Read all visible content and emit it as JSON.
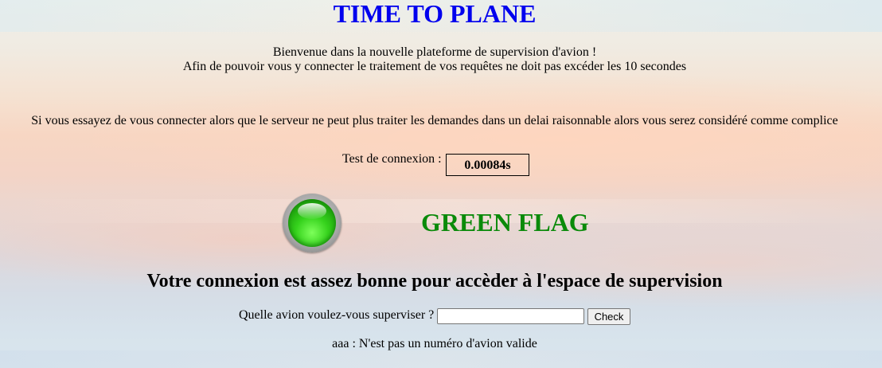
{
  "page": {
    "title": "TIME TO PLANE",
    "intro_line1": "Bienvenue dans la nouvelle plateforme de supervision d'avion !",
    "intro_line2": "Afin de pouvoir vous y connecter le traitement de vos requêtes ne doit pas excéder les 10 secondes",
    "warning": "Si vous essayez de vous connecter alors que le serveur ne peut plus traiter les demandes dans un delai raisonnable alors vous serez considéré comme complice"
  },
  "connection_test": {
    "label": "Test de connexion :",
    "value": "0.00084s"
  },
  "status": {
    "flag_text": "GREEN FLAG",
    "flag_color": "#0a8a0a",
    "light_icon": "green-light-icon",
    "message": "Votre connexion est assez bonne pour accèder à l'espace de supervision"
  },
  "plane_form": {
    "label": "Quelle avion voulez-vous superviser ?",
    "input_value": "",
    "button_label": "Check",
    "result": "aaa : N'est pas un numéro d'avion valide"
  },
  "colors": {
    "title": "#0000ee",
    "flag": "#0a8a0a"
  }
}
